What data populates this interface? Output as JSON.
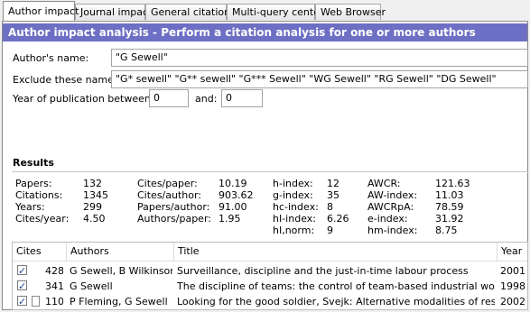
{
  "tabs": [
    {
      "label": "Author impact"
    },
    {
      "label": "Journal impact"
    },
    {
      "label": "General citations"
    },
    {
      "label": "Multi-query center"
    },
    {
      "label": "Web Browser"
    }
  ],
  "header": {
    "title": "Author impact analysis - Perform a citation analysis for one or more authors"
  },
  "form": {
    "author_label": "Author's name:",
    "author_value": "\"G Sewell\"",
    "exclude_label": "Exclude these names:",
    "exclude_value": "\"G* sewell\" \"G** sewell\" \"G*** Sewell\" \"WG Sewell\" \"RG Sewell\" \"DG Sewell\"",
    "year_label": "Year of publication between:",
    "year_from": "0",
    "and_label": "and:",
    "year_to": "0"
  },
  "results": {
    "title": "Results",
    "col1": {
      "labels": [
        "Papers:",
        "Citations:",
        "Years:",
        "Cites/year:"
      ],
      "values": [
        "132",
        "1345",
        "299",
        "4.50"
      ]
    },
    "col2": {
      "labels": [
        "Cites/paper:",
        "Cites/author:",
        "Papers/author:",
        "Authors/paper:"
      ],
      "values": [
        "10.19",
        "903.62",
        "91.00",
        "1.95"
      ]
    },
    "col3": {
      "labels": [
        "h-index:",
        "g-index:",
        "hc-index:",
        "hI-index:",
        "hI,norm:"
      ],
      "values": [
        "12",
        "35",
        "8",
        "6.26",
        "9"
      ]
    },
    "col4": {
      "labels": [
        "AWCR:",
        "AW-index:",
        "AWCRpA:",
        "e-index:",
        "hm-index:"
      ],
      "values": [
        "121.63",
        "11.03",
        "78.59",
        "31.92",
        "8.75"
      ]
    }
  },
  "table": {
    "headers": {
      "cites": "Cites",
      "authors": "Authors",
      "title": "Title",
      "year": "Year"
    },
    "rows": [
      {
        "cites": "428",
        "authors": "G Sewell, B Wilkinson",
        "title": "Surveillance, discipline and the just-in-time labour process",
        "year": "2001"
      },
      {
        "cites": "341",
        "authors": "G Sewell",
        "title": "The discipline of teams: the control of team-based industrial work thr...",
        "year": "1998"
      },
      {
        "cites": "110",
        "authors": "P Fleming, G Sewell",
        "title": "Looking for the good soldier, Svejk: Alternative modalities of resistan...",
        "year": "2002"
      }
    ]
  },
  "colors": {
    "header_bg": "#6d6fc4",
    "header_text": "#ffffff"
  }
}
